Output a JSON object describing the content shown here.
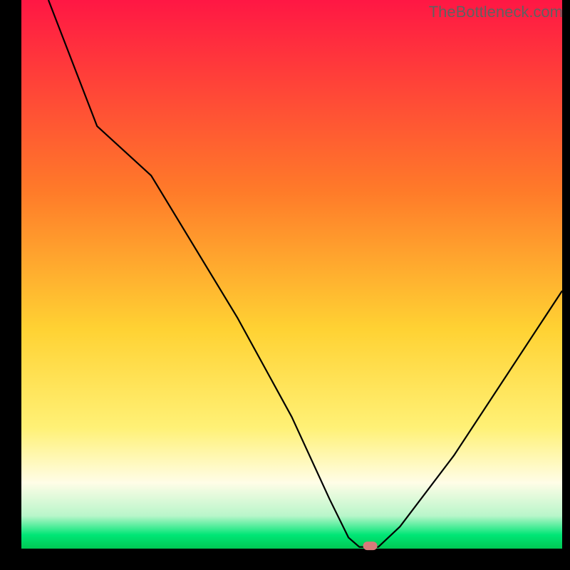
{
  "watermark": "TheBottleneck.com",
  "chart_data": {
    "type": "line",
    "title": "",
    "xlabel": "",
    "ylabel": "",
    "xlim": [
      0,
      100
    ],
    "ylim": [
      0,
      100
    ],
    "background": {
      "type": "vertical-gradient",
      "description": "Performance heat gradient from red (top/bad) through orange/yellow to green (bottom/optimal)",
      "stops": [
        {
          "pos": 0.0,
          "color": "#ff1744"
        },
        {
          "pos": 0.35,
          "color": "#ff7b29"
        },
        {
          "pos": 0.6,
          "color": "#ffd233"
        },
        {
          "pos": 0.78,
          "color": "#fff176"
        },
        {
          "pos": 0.88,
          "color": "#fffde7"
        },
        {
          "pos": 0.94,
          "color": "#b9f6ca"
        },
        {
          "pos": 0.975,
          "color": "#00e676"
        },
        {
          "pos": 1.0,
          "color": "#00c853"
        }
      ]
    },
    "curve": {
      "description": "Bottleneck curve; descends from top-left, dips to near-zero around x≈64, rises toward right",
      "points": [
        {
          "x": 5.0,
          "y": 100.0
        },
        {
          "x": 14.0,
          "y": 77.0
        },
        {
          "x": 24.0,
          "y": 68.0
        },
        {
          "x": 40.0,
          "y": 42.0
        },
        {
          "x": 50.0,
          "y": 24.0
        },
        {
          "x": 57.0,
          "y": 9.0
        },
        {
          "x": 60.5,
          "y": 2.0
        },
        {
          "x": 62.5,
          "y": 0.3
        },
        {
          "x": 66.0,
          "y": 0.3
        },
        {
          "x": 70.0,
          "y": 4.0
        },
        {
          "x": 80.0,
          "y": 17.0
        },
        {
          "x": 90.0,
          "y": 32.0
        },
        {
          "x": 100.0,
          "y": 47.0
        }
      ]
    },
    "marker": {
      "description": "Optimal point indicator",
      "x": 64.5,
      "y": 0.5,
      "color": "#d77a7a",
      "shape": "rounded-rect"
    },
    "frame_color": "#000000",
    "frame_width_left": 30,
    "frame_width_right": 11,
    "frame_width_top": 0,
    "frame_width_bottom": 30
  }
}
